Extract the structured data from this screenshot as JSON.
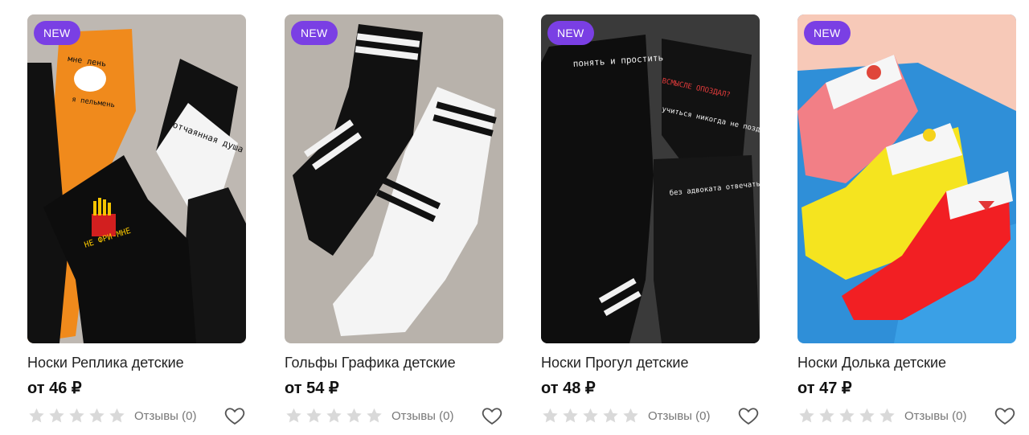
{
  "colors": {
    "badge": "#7a3fe4",
    "star_empty": "#d9d9d9",
    "heart": "#555555"
  },
  "products": [
    {
      "badge": "NEW",
      "title": "Носки Реплика детские",
      "price": "от 46 ₽",
      "reviews": "Отзывы (0)",
      "rating": 0,
      "image_text": [
        "мне лень",
        "я пельмень",
        "отчаянная душа",
        "НЕ ФРИ-МНЕ"
      ]
    },
    {
      "badge": "NEW",
      "title": "Гольфы Графика детские",
      "price": "от 54 ₽",
      "reviews": "Отзывы (0)",
      "rating": 0,
      "image_text": []
    },
    {
      "badge": "NEW",
      "title": "Носки Прогул детские",
      "price": "от 48 ₽",
      "reviews": "Отзывы (0)",
      "rating": 0,
      "image_text": [
        "понять и простить",
        "ВСМЫСЛЕ ОПОЗДАЛ?",
        "учиться никогда не поздно",
        "без адвоката отвечать не буду"
      ]
    },
    {
      "badge": "NEW",
      "title": "Носки Долька детские",
      "price": "от 47 ₽",
      "reviews": "Отзывы (0)",
      "rating": 0,
      "image_text": []
    }
  ]
}
